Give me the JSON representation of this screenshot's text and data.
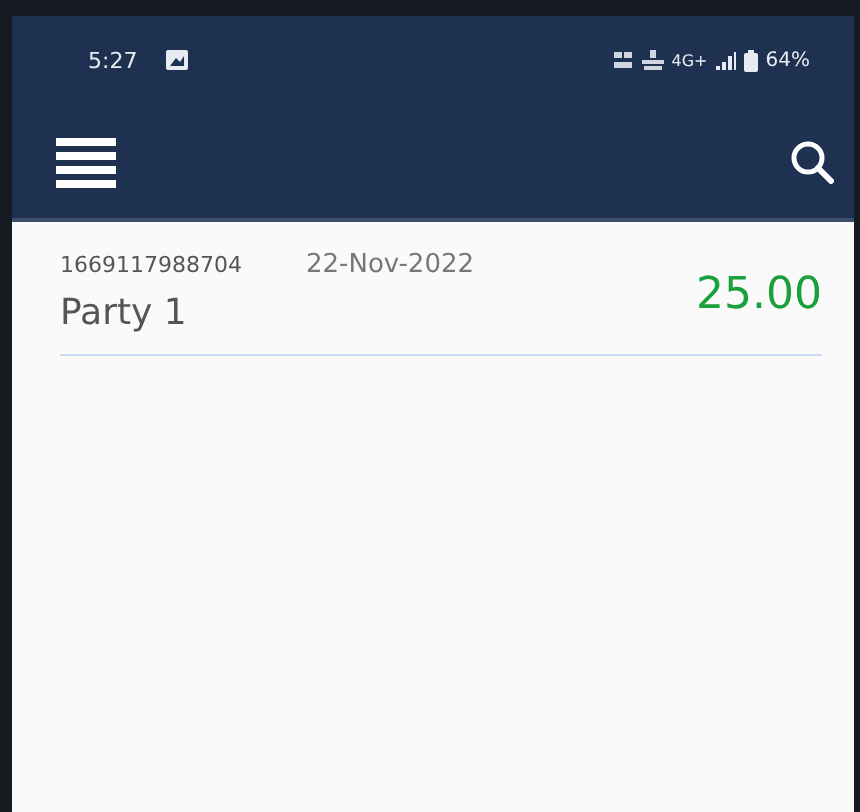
{
  "status_bar": {
    "time": "5:27",
    "network": "4G+",
    "battery": "64%"
  },
  "entries": [
    {
      "number": "1669117988704",
      "date": "22-Nov-2022",
      "party": "Party 1",
      "amount": "25.00"
    }
  ]
}
